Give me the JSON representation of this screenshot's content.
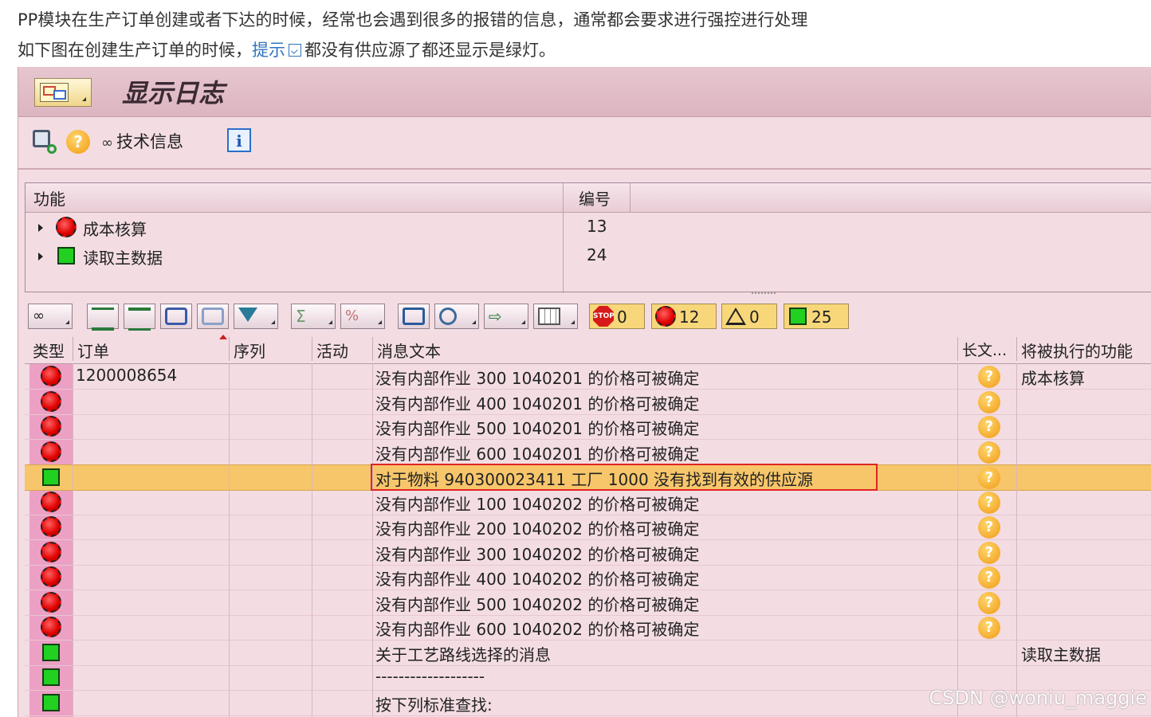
{
  "intro": {
    "line1": "PP模块在生产订单创建或者下达的时候，经常也会遇到很多的报错的信息，通常都会要求进行强控进行处理",
    "line2_prefix": "如下图在创建生产订单的时候，",
    "line2_link": "提示",
    "line2_suffix": "都没有供应源了都还显示是绿灯。"
  },
  "window": {
    "title": "显示日志"
  },
  "app_toolbar": {
    "tech_info_label": "技术信息",
    "help_glyph": "?",
    "info_glyph": "i"
  },
  "tree": {
    "columns": [
      "功能",
      "编号"
    ],
    "rows": [
      {
        "label": "成本核算",
        "number": "13",
        "status": "error"
      },
      {
        "label": "读取主数据",
        "number": "24",
        "status": "success"
      }
    ]
  },
  "counters": {
    "stop": "0",
    "error": "12",
    "warning": "0",
    "success": "25",
    "stop_label": "STOP"
  },
  "grid": {
    "columns": [
      "类型",
      "订单",
      "序列",
      "活动",
      "消息文本",
      "长文...",
      "将被执行的功能"
    ],
    "rows": [
      {
        "status": "error",
        "order": "1200008654",
        "message": "没有内部作业 300 1040201 的价格可被确定",
        "longtext": true,
        "func": "成本核算"
      },
      {
        "status": "error",
        "order": "",
        "message": "没有内部作业 400 1040201 的价格可被确定",
        "longtext": true,
        "func": ""
      },
      {
        "status": "error",
        "order": "",
        "message": "没有内部作业 500 1040201 的价格可被确定",
        "longtext": true,
        "func": ""
      },
      {
        "status": "error",
        "order": "",
        "message": "没有内部作业 600 1040201 的价格可被确定",
        "longtext": true,
        "func": ""
      },
      {
        "status": "success",
        "order": "",
        "message": "对于物料 940300023411 工厂 1000 没有找到有效的供应源",
        "longtext": true,
        "func": "",
        "highlight": true
      },
      {
        "status": "error",
        "order": "",
        "message": "没有内部作业 100 1040202 的价格可被确定",
        "longtext": true,
        "func": ""
      },
      {
        "status": "error",
        "order": "",
        "message": "没有内部作业 200 1040202 的价格可被确定",
        "longtext": true,
        "func": ""
      },
      {
        "status": "error",
        "order": "",
        "message": "没有内部作业 300 1040202 的价格可被确定",
        "longtext": true,
        "func": ""
      },
      {
        "status": "error",
        "order": "",
        "message": "没有内部作业 400 1040202 的价格可被确定",
        "longtext": true,
        "func": ""
      },
      {
        "status": "error",
        "order": "",
        "message": "没有内部作业 500 1040202 的价格可被确定",
        "longtext": true,
        "func": ""
      },
      {
        "status": "error",
        "order": "",
        "message": "没有内部作业 600 1040202 的价格可被确定",
        "longtext": true,
        "func": ""
      },
      {
        "status": "success",
        "order": "",
        "message": "关于工艺路线选择的消息",
        "longtext": false,
        "func": "读取主数据"
      },
      {
        "status": "success",
        "order": "",
        "message": "-------------------",
        "longtext": false,
        "func": ""
      },
      {
        "status": "success",
        "order": "",
        "message": "按下列标准查找:",
        "longtext": false,
        "func": ""
      }
    ]
  },
  "watermark": "CSDN @woniu_maggie",
  "colors": {
    "pink_bg": "#f3dde3",
    "highlight": "#f7c66b",
    "error_red": "#e00000",
    "success_green": "#22d022"
  }
}
